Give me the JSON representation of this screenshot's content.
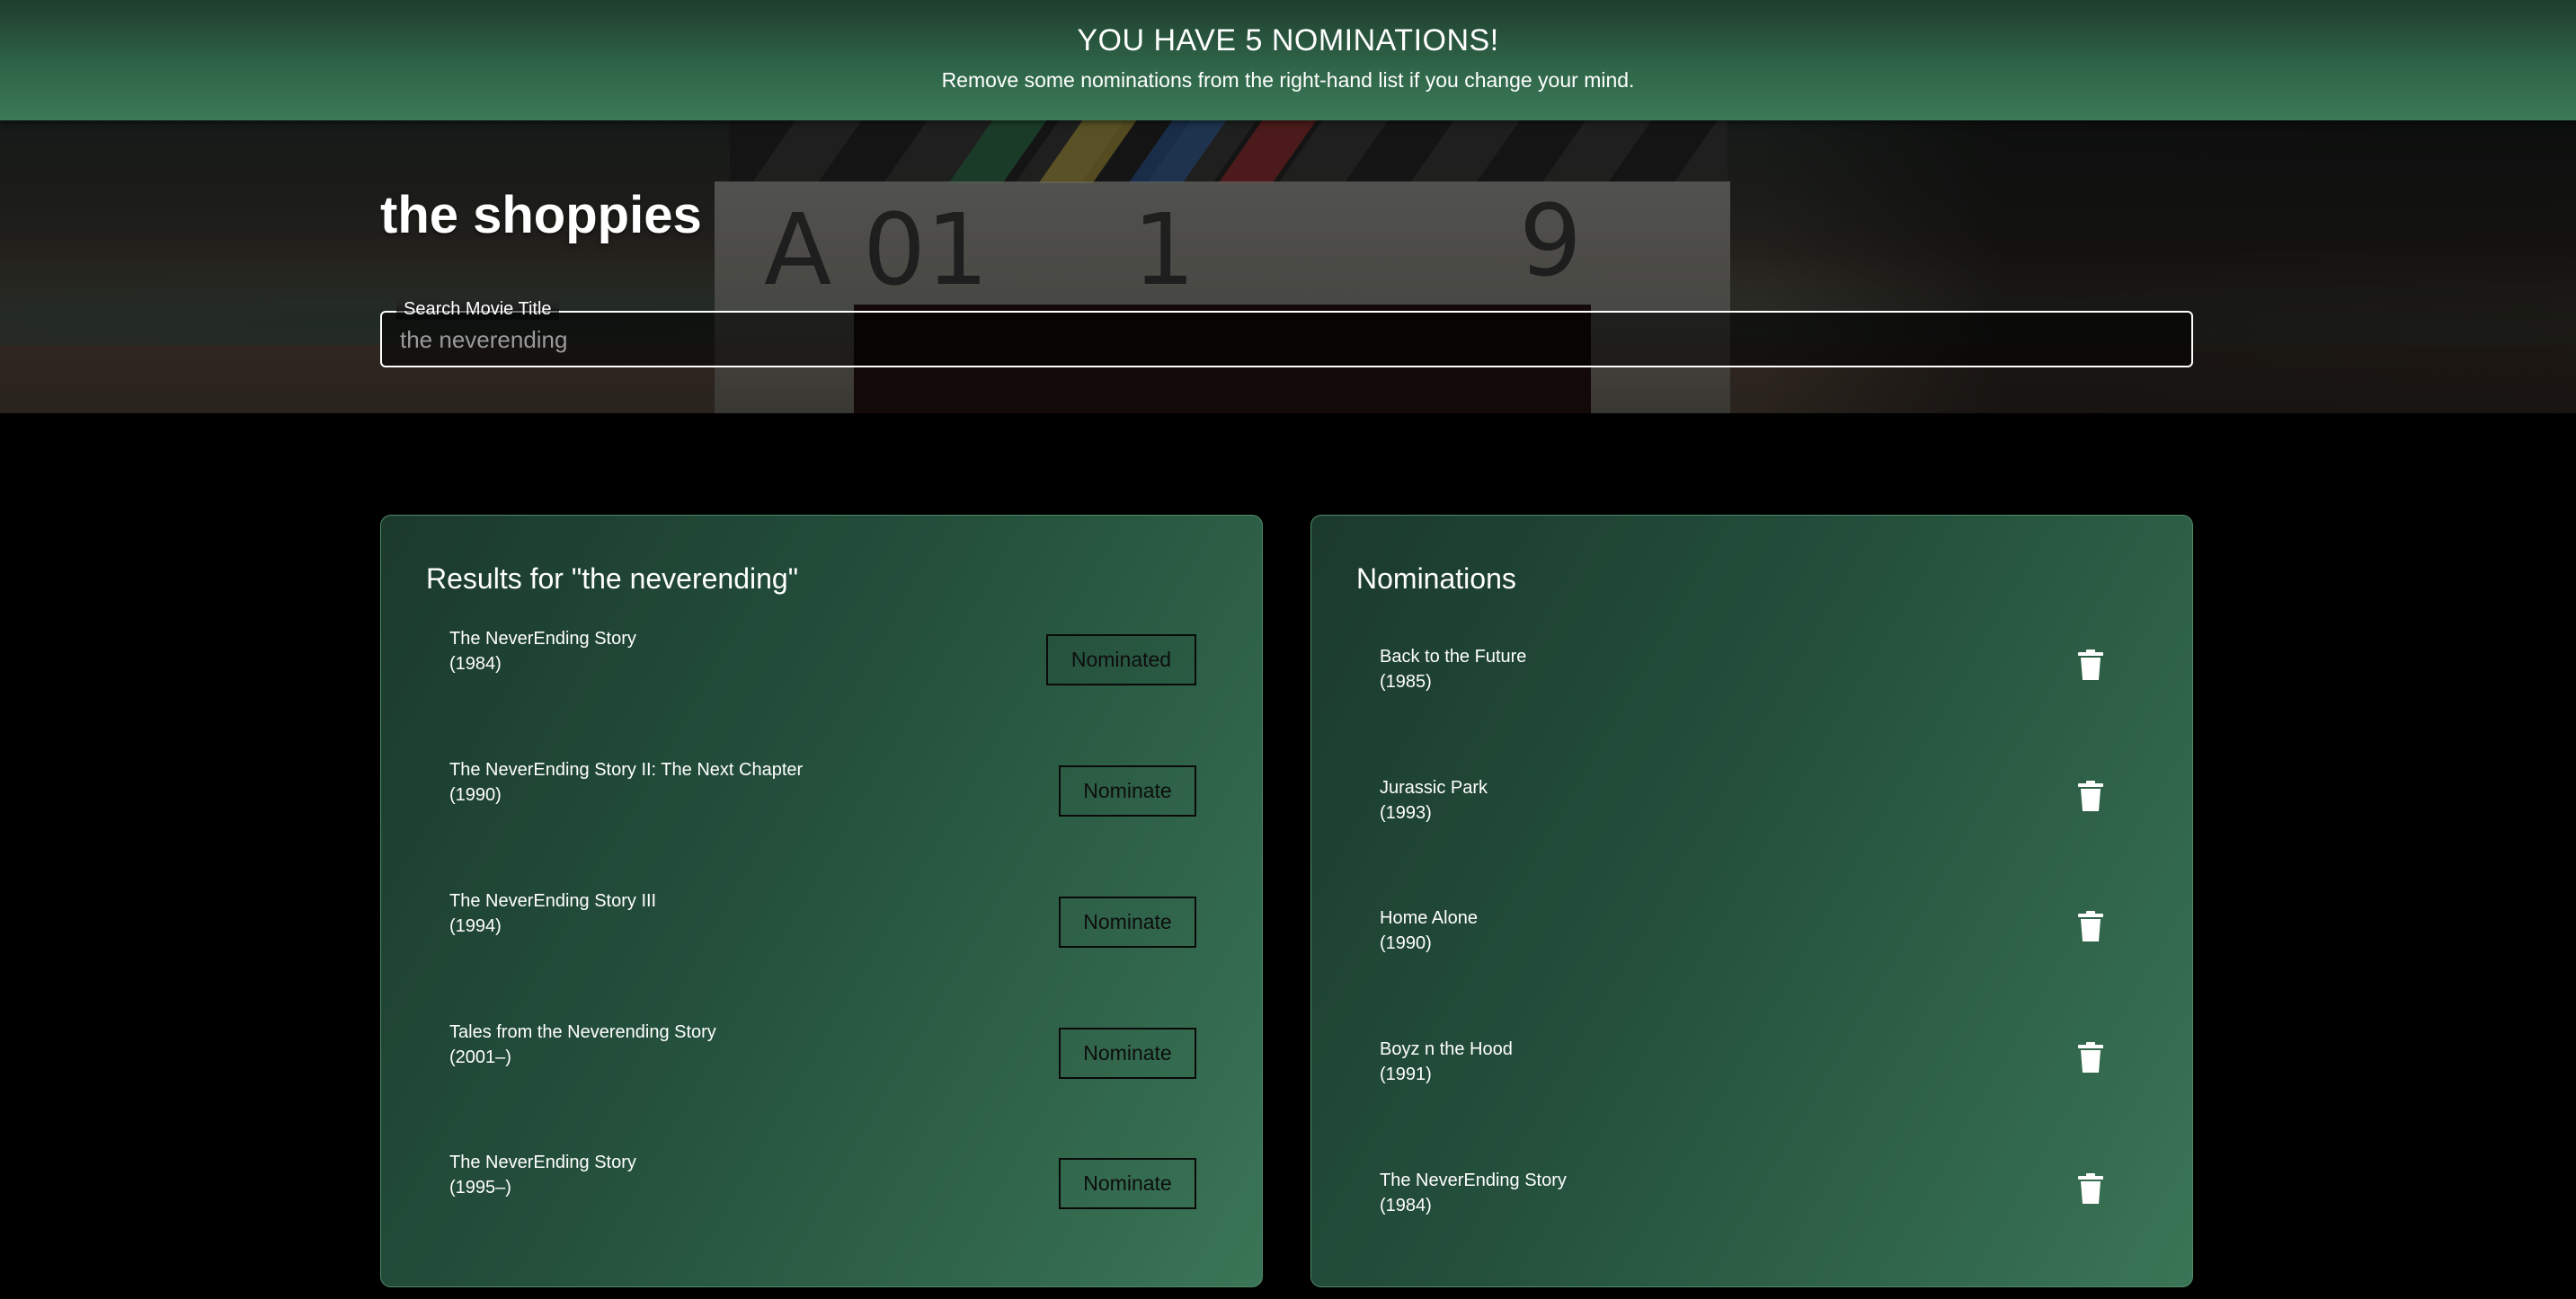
{
  "banner": {
    "title": "YOU HAVE 5 NOMINATIONS!",
    "subtitle": "Remove some nominations from the right-hand list if you change your mind."
  },
  "header": {
    "brand": "the shoppies"
  },
  "search": {
    "label": "Search Movie Title",
    "value": "",
    "placeholder": "the neverending"
  },
  "results": {
    "title": "Results for \"the neverending\"",
    "items": [
      {
        "title": "The NeverEnding Story",
        "year": "(1984)",
        "button": "Nominated",
        "nominated": true
      },
      {
        "title": "The NeverEnding Story II: The Next Chapter",
        "year": "(1990)",
        "button": "Nominate",
        "nominated": false
      },
      {
        "title": "The NeverEnding Story III",
        "year": "(1994)",
        "button": "Nominate",
        "nominated": false
      },
      {
        "title": "Tales from the Neverending Story",
        "year": "(2001–)",
        "button": "Nominate",
        "nominated": false
      },
      {
        "title": "The NeverEnding Story",
        "year": "(1995–)",
        "button": "Nominate",
        "nominated": false
      }
    ]
  },
  "nominations": {
    "title": "Nominations",
    "items": [
      {
        "title": "Back to the Future",
        "year": "(1985)",
        "icon": "trash-icon"
      },
      {
        "title": "Jurassic Park",
        "year": "(1993)",
        "icon": "trash-icon"
      },
      {
        "title": "Home Alone",
        "year": "(1990)",
        "icon": "trash-icon"
      },
      {
        "title": "Boyz n the Hood",
        "year": "(1991)",
        "icon": "trash-icon"
      },
      {
        "title": "The NeverEnding Story",
        "year": "(1984)",
        "icon": "trash-icon"
      }
    ]
  },
  "colors": {
    "banner": "#2f6448",
    "panel_gradient_start": "#1b3a2c",
    "panel_gradient_end": "#3a7556",
    "background": "#000000"
  }
}
